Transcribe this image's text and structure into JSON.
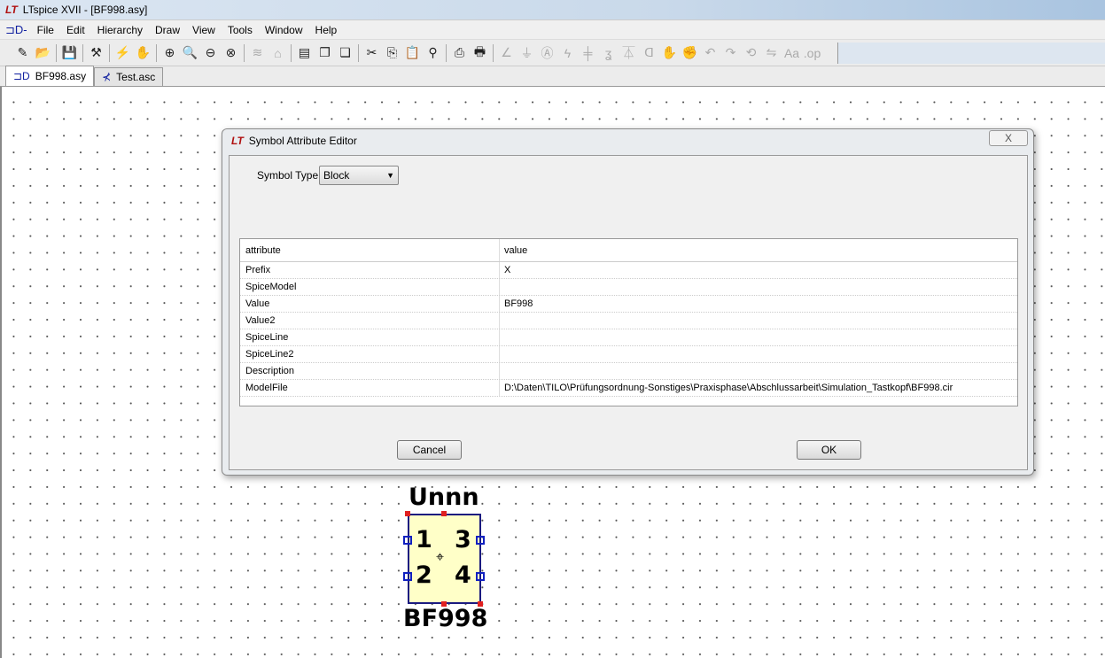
{
  "window": {
    "title": "LTspice XVII - [BF998.asy]"
  },
  "menu": [
    "File",
    "Edit",
    "Hierarchy",
    "Draw",
    "View",
    "Tools",
    "Window",
    "Help"
  ],
  "toolbar": [
    {
      "icon": "new-schematic-icon",
      "g": "✎",
      "d": false
    },
    {
      "icon": "open-folder-icon",
      "g": "📂",
      "d": false
    },
    "|",
    {
      "icon": "save-icon",
      "g": "💾",
      "d": false
    },
    "|",
    {
      "icon": "control-panel-icon",
      "g": "⚒",
      "d": false
    },
    "|",
    {
      "icon": "run-icon",
      "g": "⚡",
      "d": true
    },
    {
      "icon": "halt-hand-icon",
      "g": "✋",
      "d": true
    },
    "|",
    {
      "icon": "zoom-in-icon",
      "g": "⊕",
      "d": false
    },
    {
      "icon": "zoom-pan-icon",
      "g": "🔍",
      "d": true
    },
    {
      "icon": "zoom-out-icon",
      "g": "⊖",
      "d": false
    },
    {
      "icon": "zoom-fit-icon",
      "g": "⊗",
      "d": false
    },
    "|",
    {
      "icon": "autoscale-icon",
      "g": "≋",
      "d": true
    },
    {
      "icon": "waveform-icon",
      "g": "⌂",
      "d": true
    },
    "|",
    {
      "icon": "tile-windows-icon",
      "g": "▤",
      "d": false
    },
    {
      "icon": "cascade-windows-icon",
      "g": "❐",
      "d": false
    },
    {
      "icon": "close-windows-icon",
      "g": "❏",
      "d": false
    },
    "|",
    {
      "icon": "cut-icon",
      "g": "✂",
      "d": false
    },
    {
      "icon": "copy-icon",
      "g": "⎘",
      "d": false
    },
    {
      "icon": "paste-icon",
      "g": "📋",
      "d": false
    },
    {
      "icon": "find-icon",
      "g": "⚲",
      "d": false
    },
    "|",
    {
      "icon": "print-preview-icon",
      "g": "⎙",
      "d": false
    },
    {
      "icon": "print-icon",
      "g": "🖶",
      "d": false
    },
    "|",
    {
      "icon": "wire-icon",
      "g": "∠",
      "d": true
    },
    {
      "icon": "ground-icon",
      "g": "⏚",
      "d": true
    },
    {
      "icon": "label-icon",
      "g": "Ⓐ",
      "d": true
    },
    {
      "icon": "resistor-icon",
      "g": "ϟ",
      "d": true
    },
    {
      "icon": "capacitor-icon",
      "g": "╪",
      "d": true
    },
    {
      "icon": "inductor-icon",
      "g": "ʓ",
      "d": true
    },
    {
      "icon": "diode-icon",
      "g": "⏄",
      "d": true
    },
    {
      "icon": "component-icon",
      "g": "ᗡ",
      "d": true
    },
    {
      "icon": "move-hand-icon",
      "g": "✋",
      "d": false
    },
    {
      "icon": "drag-hand-icon",
      "g": "✊",
      "d": false
    },
    {
      "icon": "undo-icon",
      "g": "↶",
      "d": true
    },
    {
      "icon": "redo-icon",
      "g": "↷",
      "d": true
    },
    {
      "icon": "rotate-icon",
      "g": "⟲",
      "d": true
    },
    {
      "icon": "mirror-icon",
      "g": "⇋",
      "d": true
    },
    {
      "icon": "text-icon",
      "g": "Aa",
      "d": true
    },
    {
      "icon": "spice-directive-icon",
      "g": ".op",
      "d": true
    }
  ],
  "tabs": [
    {
      "label": "BF998.asy",
      "active": true
    },
    {
      "label": "Test.asc",
      "active": false
    }
  ],
  "dialog": {
    "title": "Symbol Attribute Editor",
    "close": "X",
    "symbol_type_label": "Symbol Type:",
    "symbol_type_value": "Block",
    "columns": [
      "attribute",
      "value"
    ],
    "rows": [
      {
        "attribute": "Prefix",
        "value": "X"
      },
      {
        "attribute": "SpiceModel",
        "value": ""
      },
      {
        "attribute": "Value",
        "value": "BF998"
      },
      {
        "attribute": "Value2",
        "value": ""
      },
      {
        "attribute": "SpiceLine",
        "value": ""
      },
      {
        "attribute": "SpiceLine2",
        "value": ""
      },
      {
        "attribute": "Description",
        "value": ""
      },
      {
        "attribute": "ModelFile",
        "value": "D:\\Daten\\TILO\\Prüfungsordnung-Sonstiges\\Praxisphase\\Abschlussarbeit\\Simulation_Tastkopf\\BF998.cir"
      }
    ],
    "cancel": "Cancel",
    "ok": "OK"
  },
  "symbol": {
    "inst_name": "Unnn",
    "value": "BF998",
    "pins": [
      "1",
      "2",
      "3",
      "4"
    ]
  }
}
